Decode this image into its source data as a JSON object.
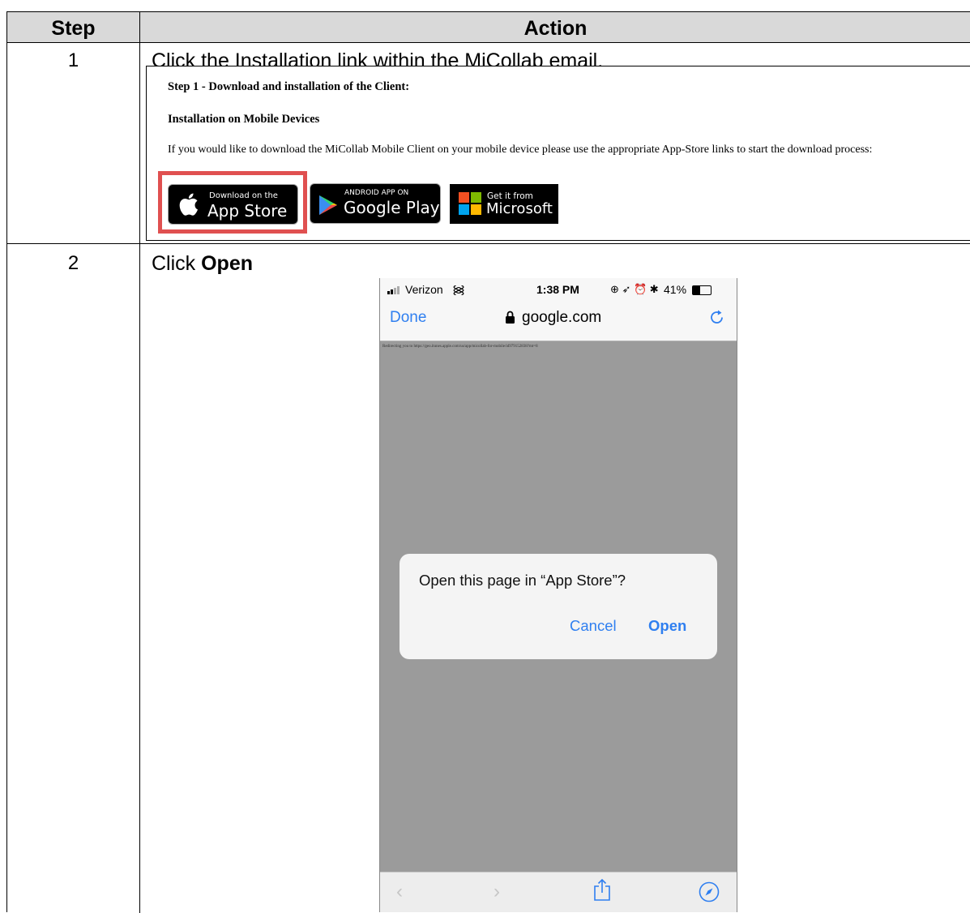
{
  "table": {
    "header_step": "Step",
    "header_action": "Action",
    "rows": [
      {
        "step": "1",
        "text": "Click the Installation link within the MiCollab email."
      },
      {
        "step": "2",
        "text_prefix": "Click ",
        "text_bold": "Open"
      }
    ]
  },
  "email": {
    "line1": "Step 1 - Download and installation of the Client:",
    "line2": "Installation on Mobile Devices",
    "line3": "If you would like to download the MiCollab Mobile Client on your mobile device please use the appropriate App-Store links to start the download process:",
    "badges": {
      "apple_small": "Download on the",
      "apple_big": "App Store",
      "google_small": "ANDROID APP ON",
      "google_big": "Google Play",
      "ms_small": "Get it from",
      "ms_big": "Microsoft"
    },
    "highlight_color": "#e05050"
  },
  "phone": {
    "carrier": "Verizon",
    "time": "1:38 PM",
    "battery": "41%",
    "done": "Done",
    "url": "google.com",
    "redirect_text": "Redirecting you to https://geo.itunes.apple.com/us/app/micollab-for-mobile/id979152838?mt=8",
    "dialog_title": "Open this page in “App Store”?",
    "dialog_cancel": "Cancel",
    "dialog_open": "Open",
    "accent_color": "#2f7ff0"
  }
}
